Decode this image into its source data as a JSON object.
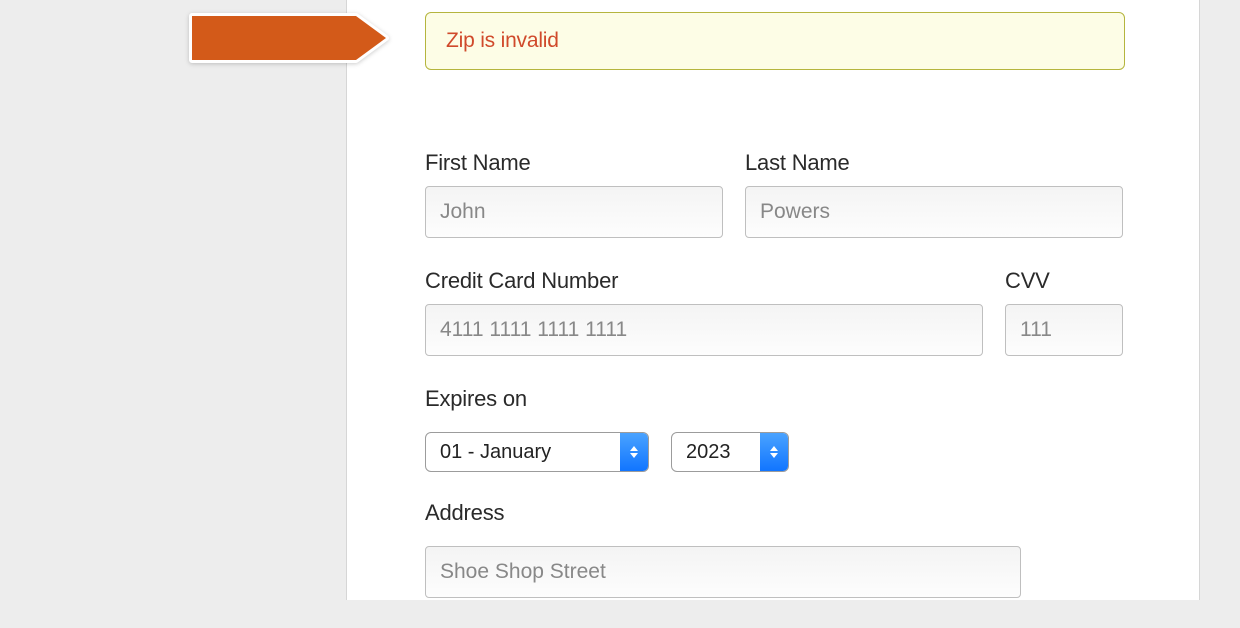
{
  "alert": {
    "message": "Zip is invalid"
  },
  "form": {
    "first_name": {
      "label": "First Name",
      "value": "John"
    },
    "last_name": {
      "label": "Last Name",
      "value": "Powers"
    },
    "credit_card": {
      "label": "Credit Card Number",
      "value": "4111 1111 1111 1111"
    },
    "cvv": {
      "label": "CVV",
      "value": "111"
    },
    "expires": {
      "label": "Expires on",
      "month": "01 - January",
      "year": "2023"
    },
    "address": {
      "label": "Address",
      "value": "Shoe Shop Street"
    }
  }
}
